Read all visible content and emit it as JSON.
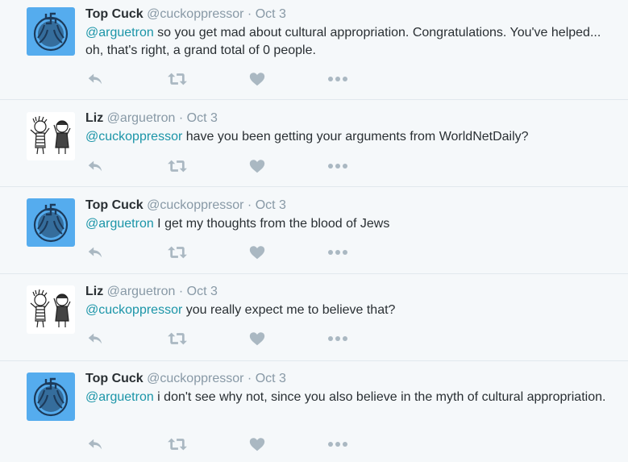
{
  "colors": {
    "background": "#f5f8fa",
    "divider": "#e1e8ed",
    "mention": "#1b95a8",
    "muted": "#8899a6",
    "action_icon": "#aab8c2",
    "text": "#292f33",
    "avatar_blue": "#55acee"
  },
  "icons": {
    "reply": "reply-icon",
    "retweet": "retweet-icon",
    "like": "heart-icon",
    "more": "more-icon"
  },
  "tweets": [
    {
      "name": "Top Cuck",
      "handle": "@cuckoppressor",
      "sep": "·",
      "time": "Oct 3",
      "mention": "@arguetron",
      "text": " so you get mad about cultural appropriation. Congratulations. You've helped... oh, that's right, a grand total of 0 people."
    },
    {
      "name": "Liz",
      "handle": "@arguetron",
      "sep": "·",
      "time": "Oct 3",
      "mention": "@cuckoppressor",
      "text": " have you been getting your arguments from WorldNetDaily?"
    },
    {
      "name": "Top Cuck",
      "handle": "@cuckoppressor",
      "sep": "·",
      "time": "Oct 3",
      "mention": "@arguetron",
      "text": " I get my thoughts from the blood of Jews"
    },
    {
      "name": "Liz",
      "handle": "@arguetron",
      "sep": "·",
      "time": "Oct 3",
      "mention": "@cuckoppressor",
      "text": " you really expect me to believe that?"
    },
    {
      "name": "Top Cuck",
      "handle": "@cuckoppressor",
      "sep": "·",
      "time": "Oct 3",
      "mention": "@arguetron",
      "text": " i don't see why not, since you also believe in the myth of cultural appropriation."
    }
  ]
}
